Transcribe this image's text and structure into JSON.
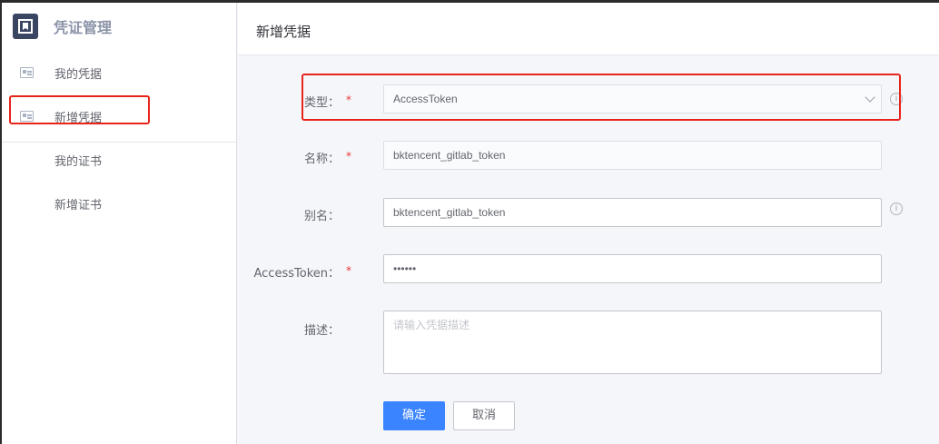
{
  "sidebar": {
    "title": "凭证管理",
    "items": [
      {
        "label": "我的凭据",
        "icon": "credential-icon"
      },
      {
        "label": "新增凭据",
        "icon": "credential-icon"
      },
      {
        "label": "我的证书",
        "icon": ""
      },
      {
        "label": "新增证书",
        "icon": ""
      }
    ]
  },
  "header": {
    "title": "新增凭据"
  },
  "form": {
    "type": {
      "label": "类型：",
      "required": "*",
      "value": "AccessToken"
    },
    "name": {
      "label": "名称：",
      "required": "*",
      "value": "bktencent_gitlab_token"
    },
    "alias": {
      "label": "别名：",
      "value": "bktencent_gitlab_token"
    },
    "token": {
      "label": "AccessToken：",
      "required": "*",
      "value": "••••••"
    },
    "desc": {
      "label": "描述：",
      "placeholder": "请输入凭据描述"
    },
    "info_glyph": "i",
    "confirm_label": "确定",
    "cancel_label": "取消"
  },
  "colors": {
    "primary": "#3a84ff",
    "highlight": "#e8231a",
    "required": "#ea3636"
  }
}
